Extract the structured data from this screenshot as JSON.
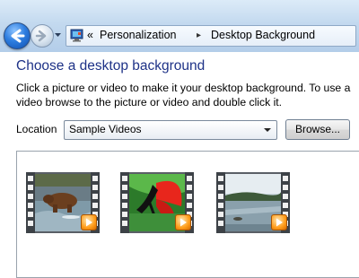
{
  "nav": {
    "breadcrumb_prefix": "«",
    "breadcrumb": [
      "Personalization",
      "Desktop Background"
    ],
    "separator": "▸"
  },
  "page": {
    "heading": "Choose a desktop background",
    "description": "Click a picture or video to make it your desktop background. To use a video browse to the picture or video and double click it."
  },
  "location": {
    "label": "Location",
    "selected": "Sample Videos",
    "browse_label": "Browse..."
  },
  "thumbnails": [
    {
      "subject": "bear-in-river"
    },
    {
      "subject": "butterfly-on-leaf"
    },
    {
      "subject": "lake-landscape"
    }
  ],
  "icons": {
    "back": "arrow-left-icon",
    "forward": "arrow-right-icon",
    "address": "control-panel-icon",
    "play": "play-icon"
  }
}
